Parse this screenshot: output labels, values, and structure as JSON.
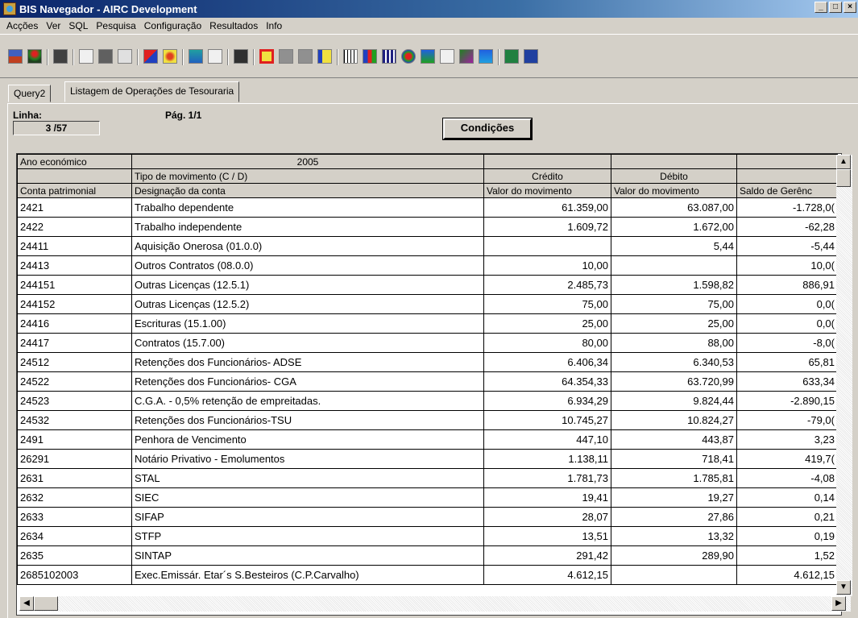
{
  "window": {
    "title": "BIS Navegador - AIRC Development",
    "controls": [
      "_",
      "□",
      "×"
    ]
  },
  "menu": [
    "Acções",
    "Ver",
    "SQL",
    "Pesquisa",
    "Configuração",
    "Resultados",
    "Info"
  ],
  "toolbar": {
    "icons": [
      "filter-icon",
      "traffic-light-icon",
      "copy-icon",
      "print-preview-icon",
      "print-icon",
      "database-icon",
      "cube-icon",
      "gear-icon",
      "chart-icon",
      "sort-icon",
      "save-icon",
      "frame-icon",
      "blank-icon",
      "blank-icon",
      "arrow-icon",
      "grid-icon",
      "bar-chart-icon",
      "column-chart-icon",
      "pie-chart-icon",
      "area-chart-icon",
      "line-chart-icon",
      "surface-chart-icon",
      "stacked-chart-icon",
      "excel-icon",
      "word-icon"
    ]
  },
  "tabs": [
    {
      "label": "Query2"
    },
    {
      "label": "Listagem de Operações de Tesouraria"
    }
  ],
  "info": {
    "linha_label": "Linha:",
    "linha_value": "3 /57",
    "pag_label": "Pág. 1/1",
    "conditions_button": "Condições"
  },
  "grid": {
    "header1": {
      "c1": "Ano económico",
      "c2": "2005",
      "c3": "",
      "c4": "",
      "c5": ""
    },
    "header2": {
      "c1": "",
      "c2": "Tipo de movimento (C / D)",
      "c3": "Crédito",
      "c4": "Débito",
      "c5": ""
    },
    "header3": {
      "c1": "Conta patrimonial",
      "c2": "Designação da conta",
      "c3": "Valor do movimento",
      "c4": "Valor do movimento",
      "c5": "Saldo de Gerênc"
    },
    "rows": [
      [
        "2421",
        "Trabalho dependente",
        "61.359,00",
        "63.087,00",
        "-1.728,0("
      ],
      [
        "2422",
        "Trabalho independente",
        "1.609,72",
        "1.672,00",
        "-62,28"
      ],
      [
        "24411",
        "Aquisição Onerosa (01.0.0)",
        "",
        "5,44",
        "-5,44"
      ],
      [
        "24413",
        "Outros Contratos (08.0.0)",
        "10,00",
        "",
        "10,0("
      ],
      [
        "244151",
        "Outras Licenças (12.5.1)",
        "2.485,73",
        "1.598,82",
        "886,91"
      ],
      [
        "244152",
        "Outras Licenças (12.5.2)",
        "75,00",
        "75,00",
        "0,0("
      ],
      [
        "24416",
        "Escrituras (15.1.00)",
        "25,00",
        "25,00",
        "0,0("
      ],
      [
        "24417",
        "Contratos (15.7.00)",
        "80,00",
        "88,00",
        "-8,0("
      ],
      [
        "24512",
        "Retenções dos Funcionários- ADSE",
        "6.406,34",
        "6.340,53",
        "65,81"
      ],
      [
        "24522",
        "Retenções dos Funcionários- CGA",
        "64.354,33",
        "63.720,99",
        "633,34"
      ],
      [
        "24523",
        "C.G.A. -  0,5% retenção de empreitadas.",
        "6.934,29",
        "9.824,44",
        "-2.890,15"
      ],
      [
        "24532",
        "Retenções dos Funcionários-TSU",
        "10.745,27",
        "10.824,27",
        "-79,0("
      ],
      [
        "2491",
        "Penhora de Vencimento",
        "447,10",
        "443,87",
        "3,23"
      ],
      [
        "26291",
        "Notário Privativo - Emolumentos",
        "1.138,11",
        "718,41",
        "419,7("
      ],
      [
        "2631",
        "STAL",
        "1.781,73",
        "1.785,81",
        "-4,08"
      ],
      [
        "2632",
        "SIEC",
        "19,41",
        "19,27",
        "0,14"
      ],
      [
        "2633",
        "SIFAP",
        "28,07",
        "27,86",
        "0,21"
      ],
      [
        "2634",
        "STFP",
        "13,51",
        "13,32",
        "0,19"
      ],
      [
        "2635",
        "SINTAP",
        "291,42",
        "289,90",
        "1,52"
      ],
      [
        "2685102003",
        "Exec.Emissár. Etar´s S.Besteiros (C.P.Carvalho)",
        "4.612,15",
        "",
        "4.612,15"
      ]
    ]
  }
}
